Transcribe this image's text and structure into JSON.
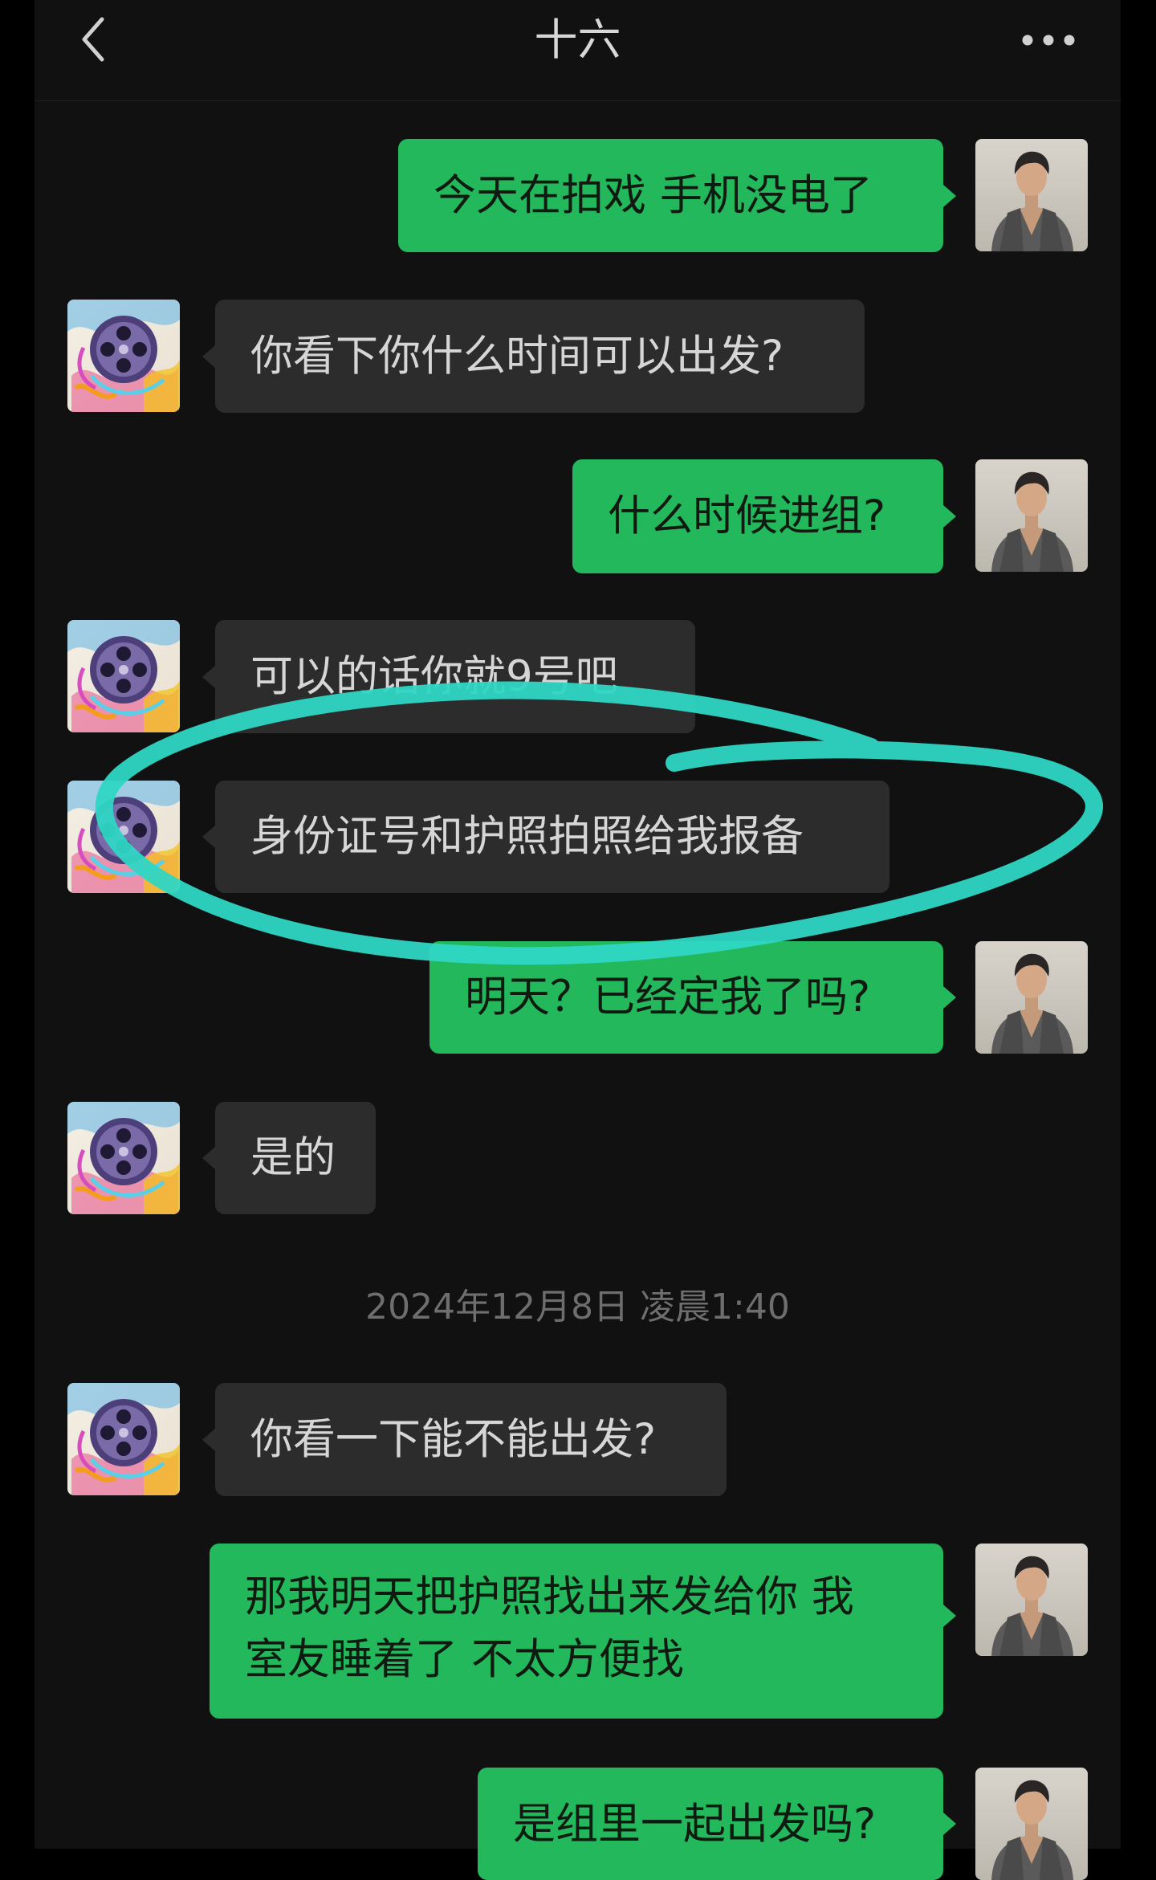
{
  "header": {
    "title": "十六",
    "back_icon": "chevron-left-icon",
    "more_icon": "more-horizontal-icon"
  },
  "messages": [
    {
      "side": "right",
      "text": "今天在拍戏 手机没电了"
    },
    {
      "side": "left",
      "text": "你看下你什么时间可以出发?"
    },
    {
      "side": "right",
      "text": "什么时候进组?"
    },
    {
      "side": "left",
      "text": "可以的话你就9号吧"
    },
    {
      "side": "left",
      "text": "身份证号和护照拍照给我报备"
    },
    {
      "side": "right",
      "text": "明天？已经定我了吗?"
    },
    {
      "side": "left",
      "text": "是的"
    },
    {
      "side": "left",
      "text": "你看一下能不能出发?"
    },
    {
      "side": "right",
      "line1": "那我明天把护照找出来发给你 我",
      "line2": "室友睡着了 不太方便找"
    },
    {
      "side": "right",
      "text": "是组里一起出发吗?"
    }
  ],
  "timestamp": "2024年12月8日 凌晨1:40",
  "colors": {
    "background": "#111111",
    "sent_bubble": "#24b85c",
    "received_bubble": "#2c2c2c",
    "annotation": "#2fd6c4"
  }
}
